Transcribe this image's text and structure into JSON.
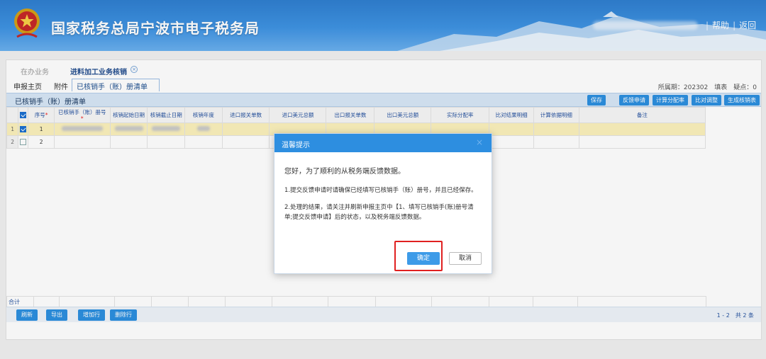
{
  "header": {
    "site_title": "国家税务总局宁波市电子税务局",
    "links": [
      "帮助",
      "返回"
    ]
  },
  "tabs_top": {
    "inactive": "在办业务",
    "active": "进料加工业务核销"
  },
  "tabs_sub": [
    "申报主页",
    "附件",
    "已核销手（账）册清单"
  ],
  "period_info": "所属期：202302　填表　疑点：0",
  "list": {
    "title": "已核销手（账）册清单",
    "toolbar": [
      "保存",
      "反馈申请",
      "计算分配率",
      "比对调整",
      "生成核销表"
    ],
    "columns": [
      "序号",
      "已核销手（账）册号",
      "核销起始日期",
      "核销截止日期",
      "核销年度",
      "进口报关单数",
      "进口美元总额",
      "出口报关单数",
      "出口美元总额",
      "实际分配率",
      "比对结果明细",
      "计算依据明细",
      "备注"
    ],
    "rows": [
      {
        "rownum": "1",
        "checked": true,
        "seq": "1"
      },
      {
        "rownum": "2",
        "checked": false,
        "seq": "2"
      }
    ],
    "sum_label": "合计",
    "bottom_buttons": [
      "刷新",
      "导出",
      "增加行",
      "删除行"
    ],
    "pager": "1 - 2　共 2 条"
  },
  "dialog": {
    "title": "温馨提示",
    "greeting": "您好，为了顺利的从税务端反馈数据。",
    "item1": "1.提交反馈申请时请确保已经填写已核销手（账）册号，并且已经保存。",
    "item2": "2.处理的结果，请关注并刷新申报主页中【1、填写已核销手(账)册号清单;提交反馈申请】后的状态，以及税务端反馈数据。",
    "ok": "确定",
    "cancel": "取消"
  },
  "colors": {
    "accent": "#2c8fdf",
    "header_blue": "#3f93e2",
    "selected_row": "#fbf1bc",
    "highlight": "#e02020"
  }
}
